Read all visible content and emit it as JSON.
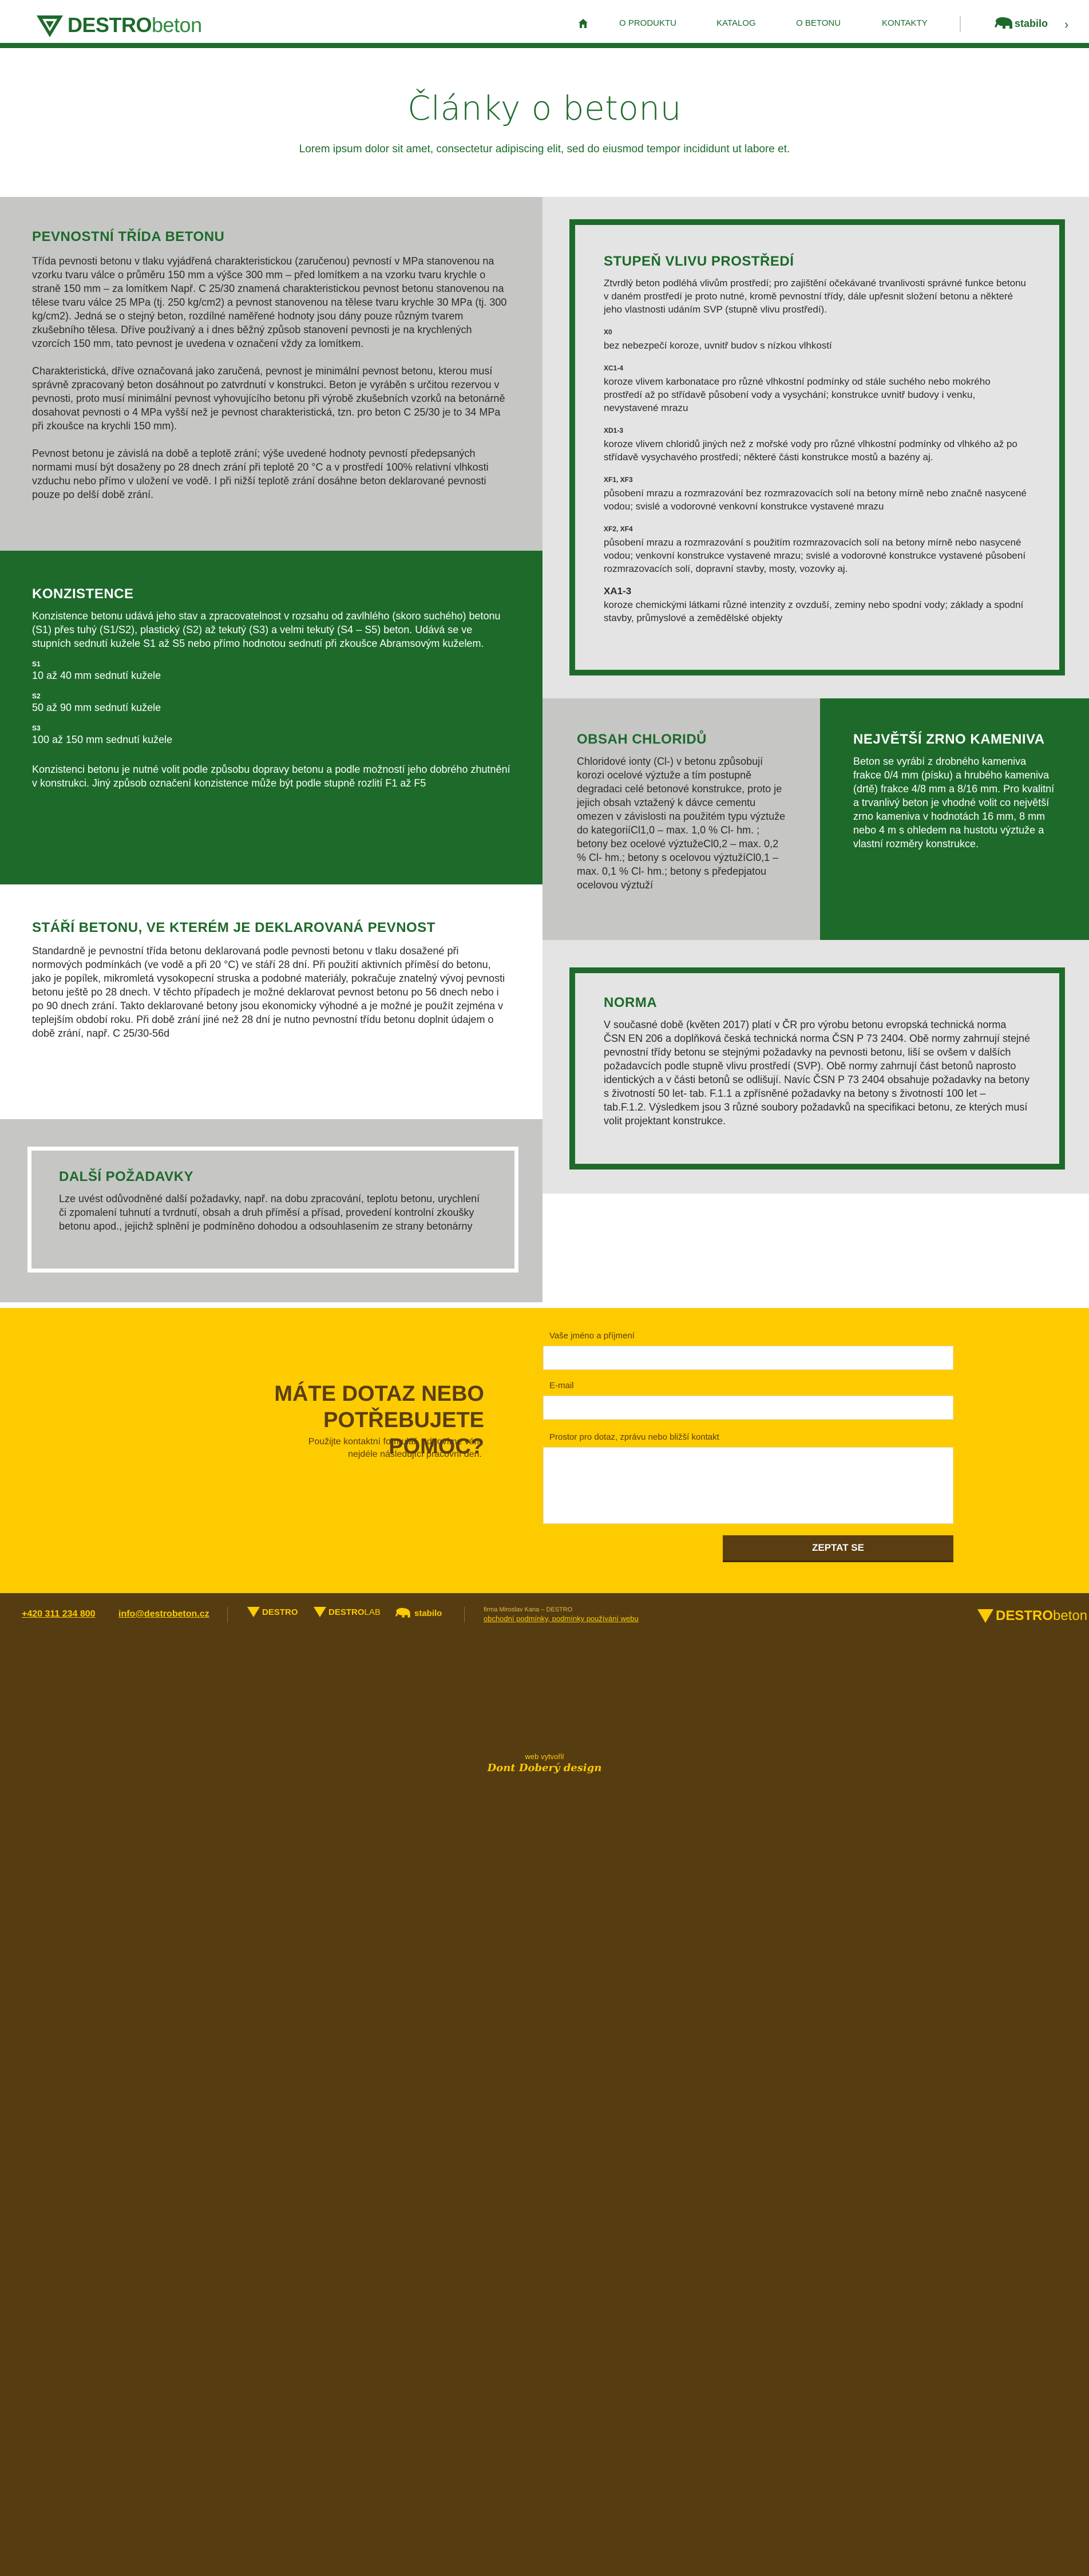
{
  "header": {
    "logo_bold": "DESTRO",
    "logo_light": "beton",
    "nav": [
      "O PRODUKTU",
      "KATALOG",
      "O BETONU",
      "KONTAKTY"
    ],
    "stabilo": "stabilo",
    "arrow": "›"
  },
  "hero": {
    "title": "Články o betonu",
    "subtitle": "Lorem ipsum dolor sit amet, consectetur adipiscing elit, sed do eiusmod tempor incididunt ut labore et."
  },
  "pevnost": {
    "title": "PEVNOSTNÍ TŘÍDA BETONU",
    "p1": "Třída pevnosti betonu v tlaku vyjádřená  charakteristickou (zaručenou) pevností v MPa stanovenou na vzorku tvaru válce  o průměru 150 mm a výšce 300 mm – před lomítkem a na vzorku tvaru krychle o straně 150 mm – za lomítkem Např. C 25/30 znamená charakteristickou pevnost betonu stanovenou na tělese tvaru válce 25 MPa (tj. 250 kg/cm2) a pevnost stanovenou na tělese tvaru krychle 30 MPa (tj. 300 kg/cm2). Jedná se o stejný beton, rozdílné naměřené hodnoty jsou dány pouze různým tvarem zkušebního tělesa. Dříve používaný a i dnes běžný způsob stanovení pevnosti je na krychlených vzorcích 150 mm, tato pevnost je uvedena v označení vždy za lomítkem.",
    "p2": "Charakteristická, dříve označovaná jako zaručená, pevnost je minimální pevnost betonu, kterou musí správně zpracovaný beton dosáhnout po zatvrdnutí v konstrukci. Beton je vyráběn s určitou rezervou v pevnosti, proto musí minimální pevnost vyhovujícího betonu při výrobě zkušebních vzorků na betonárně dosahovat pevnosti o 4 MPa vyšší než je pevnost charakteristická, tzn. pro beton C 25/30 je to 34 MPa při zkoušce na krychli 150 mm).",
    "p3": "Pevnost betonu je závislá na době a teplotě zrání; výše uvedené hodnoty pevností předepsaných normami musí být dosaženy po 28 dnech zrání při teplotě 20 °C a v prostředí 100% relativní vlhkosti vzduchu nebo přímo v uložení ve vodě. I při nižší teplotě zrání dosáhne beton deklarované pevnosti pouze po delší době zrání."
  },
  "konzistence": {
    "title": "KONZISTENCE",
    "intro": "Konzistence betonu udává jeho stav a zpracovatelnost v rozsahu od zavlhlého (skoro suchého) betonu (S1) přes tuhý (S1/S2), plastický (S2) až tekutý (S3) a velmi tekutý (S4 – S5) beton. Udává se ve stupních  sednutí kužele S1 až S5 nebo přímo hodnotou sednutí při zkoušce Abramsovým kuželem.",
    "levels": [
      {
        "code": "S1",
        "text": "10 až 40 mm sednutí kužele"
      },
      {
        "code": "S2",
        "text": "50 až 90 mm sednutí kužele"
      },
      {
        "code": "S3",
        "text": "100 až 150 mm sednutí kužele"
      }
    ],
    "outro": "Konzistenci betonu je nutné volit podle způsobu dopravy betonu a podle možností jeho dobrého zhutnění v konstrukci. Jiný způsob označení konzistence může být podle stupně rozlití F1 až F5"
  },
  "stari": {
    "title": "STÁŘÍ BETONU, VE KTERÉM JE DEKLAROVANÁ PEVNOST",
    "text": "Standardně je pevnostní třída betonu deklarovaná podle pevnosti betonu v tlaku dosažené při normových podmínkách (ve vodě a při 20 °C) ve stáří 28 dní.  Při použití aktivních příměsí do betonu, jako je popílek, mikromletá vysokopecní struska a podobné materiály, pokračuje znatelný vývoj pevnosti betonu ještě po 28 dnech. V těchto případech je možné deklarovat pevnost betonu po 56 dnech nebo i po 90 dnech zrání. Takto deklarované betony jsou ekonomicky výhodné a je možné je použít zejména v teplejším období roku. Při době zrání jiné než 28 dní je nutno pevnostní třídu betonu doplnit údajem o době zrání, např. C 25/30-56d"
  },
  "dalsi": {
    "title": "DALŠÍ POŽADAVKY",
    "text": "Lze uvést odůvodněné další požadavky, např. na dobu zpracování, teplotu betonu, urychlení či zpomalení tuhnutí a tvrdnutí, obsah a druh příměsí a přísad, provedení kontrolní zkoušky betonu apod., jejichž splnění je podmíněno dohodou a odsouhlasením ze strany betonárny"
  },
  "stupen": {
    "title": "STUPEŇ VLIVU PROSTŘEDÍ",
    "intro": "Ztvrdlý beton podléhá vlivům prostředí; pro zajištění očekávané trvanlivosti správné funkce betonu v daném prostředí je proto nutné, kromě pevnostní třídy, dále upřesnit složení betonu a některé jeho vlastnosti udáním SVP (stupně vlivu prostředí).",
    "items": [
      {
        "code": "X0",
        "text": "bez nebezpečí koroze, uvnitř budov s nízkou vlhkostí"
      },
      {
        "code": "XC1-4",
        "text": "koroze vlivem karbonatace pro různé vlhkostní podmínky od stále suchého nebo mokrého prostředí až po střídavě působení vody a vysychání; konstrukce uvnitř budovy i venku, nevystavené mrazu"
      },
      {
        "code": "XD1-3",
        "text": "koroze vlivem chloridů jiných než z mořské vody pro různé vlhkostní podmínky od vlhkého až po střídavě vysychavého prostředí; některé části konstrukce mostů a bazény aj."
      },
      {
        "code": "XF1, XF3",
        "text": "působení mrazu a rozmrazování bez rozmrazovacích solí na betony mírně nebo značně nasycené vodou; svislé a vodorovné venkovní konstrukce vystavené mrazu"
      },
      {
        "code": "XF2, XF4",
        "text": "působení mrazu a rozmrazování s použitím rozmrazovacích solí na betony mírně nebo nasycené vodou; venkovní konstrukce vystavené mrazu; svislé a vodorovné konstrukce vystavené působení rozmrazovacích solí, dopravní stavby, mosty, vozovky aj."
      },
      {
        "code": "XA1-3",
        "text": "koroze chemickými látkami různé intenzity z ovzduší, zeminy nebo spodní vody; základy a spodní stavby, průmyslové a zemědělské objekty"
      }
    ]
  },
  "chloridy": {
    "title": "OBSAH CHLORIDŮ",
    "text": "Chloridové ionty (Cl-) v betonu způsobují korozi ocelové výztuže a tím postupně degradaci celé betonové konstrukce, proto je jejich obsah vztažený k dávce cementu omezen v závislosti na použitém typu výztuže do kategoriíCl1,0 – max. 1,0 % Cl- hm. ; betony bez ocelové výztužeCl0,2 – max. 0,2 % Cl- hm.; betony s ocelovou výztužíCl0,1 – max. 0,1 % Cl- hm.;  betony s předepjatou ocelovou výztuží"
  },
  "zrno": {
    "title": "NEJVĚTŠÍ ZRNO KAMENIVA",
    "text": "Beton se vyrábí z drobného kameniva frakce 0/4 mm (písku) a hrubého kameniva (drtě) frakce 4/8 mm a 8/16 mm. Pro kvalitní a trvanlivý beton je vhodné volit co největší zrno kameniva v hodnotách 16 mm, 8 mm nebo 4 m  s ohledem na hustotu výztuže a vlastní rozměry konstrukce."
  },
  "norma": {
    "title": "NORMA",
    "text": "V současné době (květen 2017) platí v ČR pro výrobu betonu evropská technická norma ČSN EN 206 a doplňková česká technická norma ČSN P 73 2404. Obě normy zahrnují stejné pevnostní třídy betonu se stejnými požadavky na pevnosti betonu, liší se ovšem v dalších požadavcích podle stupně vlivu prostředí (SVP). Obě normy zahrnují část betonů naprosto identických a v části betonů se odlišují. Navíc ČSN P 73 2404 obsahuje požadavky na betony s životností 50 let- tab. F.1.1 a zpřísněné požadavky na betony s životností 100 let – tab.F.1.2. Výsledkem jsou 3 různé soubory požadavků na specifikaci betonu, ze kterých musí volit projektant konstrukce."
  },
  "contact": {
    "title_line1": "MÁTE DOTAZ NEBO",
    "title_line2": "POTŘEBUJETE POMOC?",
    "sub": "Použijte kontaktní formulář, odpovíme vám nejdéle následující pracovní den.",
    "name_label": "Vaše jméno a příjmení",
    "email_label": "E-mail",
    "message_label": "Prostor pro dotaz, zprávu nebo bližší kontakt",
    "name_value": "",
    "email_value": "",
    "message_value": "",
    "submit": "ZEPTAT SE"
  },
  "footer": {
    "phone": "+420 311 234 800",
    "email": "info@destrobeton.cz",
    "brand1": "DESTRO",
    "brand2_bold": "DESTRO",
    "brand2_light": "LAB",
    "brand3": "stabilo",
    "company": "firma Miroslav Kana – DESTRO",
    "terms": "obchodní podmínky, podmínky používání webu",
    "logo_bold": "DESTRO",
    "logo_light": "beton",
    "credit_small": "web vytvořil",
    "credit_name": "Dont Doberý design"
  },
  "colors": {
    "primary_green": "#1d6a2b",
    "gray_panel": "#c6c6c5",
    "light_gray": "#e4e4e4",
    "yellow": "#fecb00",
    "brown": "#553c11"
  }
}
